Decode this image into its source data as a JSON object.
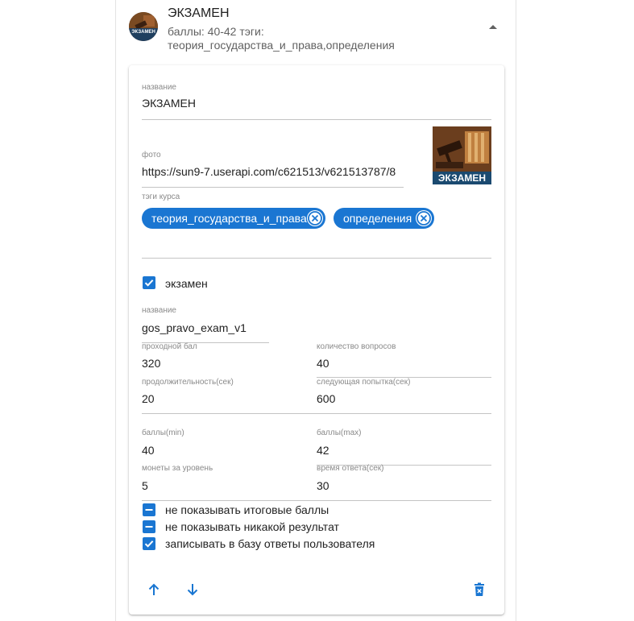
{
  "header": {
    "title": "ЭКЗАМЕН",
    "subtitle_line1": "баллы: 40-42 тэги:",
    "subtitle_line2": "теория_государства_и_права,определения",
    "avatar_badge": "ЭКЗАМЕН"
  },
  "form": {
    "name_label": "название",
    "name_value": "ЭКЗАМЕН",
    "photo_label": "фото",
    "photo_value": "https://sun9-7.userapi.com/c621513/v621513787/8",
    "photo_badge": "ЭКЗАМЕН",
    "tags_label": "тэги курса",
    "tags": [
      "теория_государства_и_права",
      "определения"
    ],
    "exam_checkbox_label": "экзамен",
    "exam_name_label": "название",
    "exam_name_value": "gos_pravo_exam_v1",
    "pass_score_label": "проходной бал",
    "pass_score_value": "320",
    "questions_count_label": "количество вопросов",
    "questions_count_value": "40",
    "duration_label": "продолжительность(сек)",
    "duration_value": "20",
    "next_attempt_label": "следующая попытка(сек)",
    "next_attempt_value": "600",
    "score_min_label": "баллы(min)",
    "score_min_value": "40",
    "score_max_label": "баллы(max)",
    "score_max_value": "42",
    "coins_label": "монеты за уровень",
    "coins_value": "5",
    "answer_time_label": "время ответа(сек)",
    "answer_time_value": "30",
    "option_hide_total": "не показывать итоговые баллы",
    "option_hide_result": "не показывать никакой результат",
    "option_save_answers": "записывать в базу ответы пользователя"
  },
  "checkbox_states": {
    "exam": "checked",
    "hide_total": "indeterminate",
    "hide_result": "indeterminate",
    "save_answers": "checked"
  },
  "icons": {
    "expand": "chevron-up-icon",
    "chip_remove": "close-circle-icon",
    "move_up": "arrow-up-icon",
    "move_down": "arrow-down-icon",
    "delete": "trash-icon"
  },
  "colors": {
    "accent": "#1a76d2",
    "icon": "#1976d2",
    "divider": "#c4c4c4"
  }
}
